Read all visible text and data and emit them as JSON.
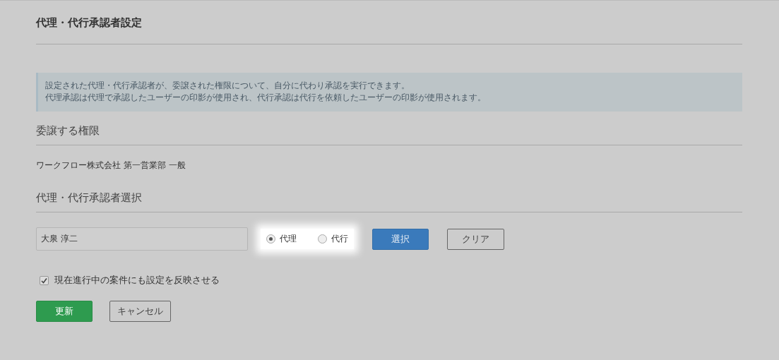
{
  "title": "代理・代行承認者設定",
  "info": [
    "設定された代理・代行承認者が、委譲された権限について、自分に代わり承認を実行できます。",
    "代理承認は代理で承認したユーザーの印影が使用され、代行承認は代行を依頼したユーザーの印影が使用されます。"
  ],
  "delegated_section": {
    "heading": "委譲する権限",
    "value": "ワークフロー株式会社 第一営業部 一般"
  },
  "approver_section": {
    "heading": "代理・代行承認者選択",
    "name_field": {
      "value": "大泉 淳二"
    },
    "modes": [
      {
        "label": "代理",
        "selected": true
      },
      {
        "label": "代行",
        "selected": false
      }
    ],
    "select_button": "選択",
    "clear_button": "クリア"
  },
  "reflect_checkbox": {
    "label": "現在進行中の案件にも設定を反映させる",
    "checked": true
  },
  "buttons": [
    {
      "label": "更新",
      "kind": "primary"
    },
    {
      "label": "キャンセル",
      "kind": "secondary"
    }
  ]
}
